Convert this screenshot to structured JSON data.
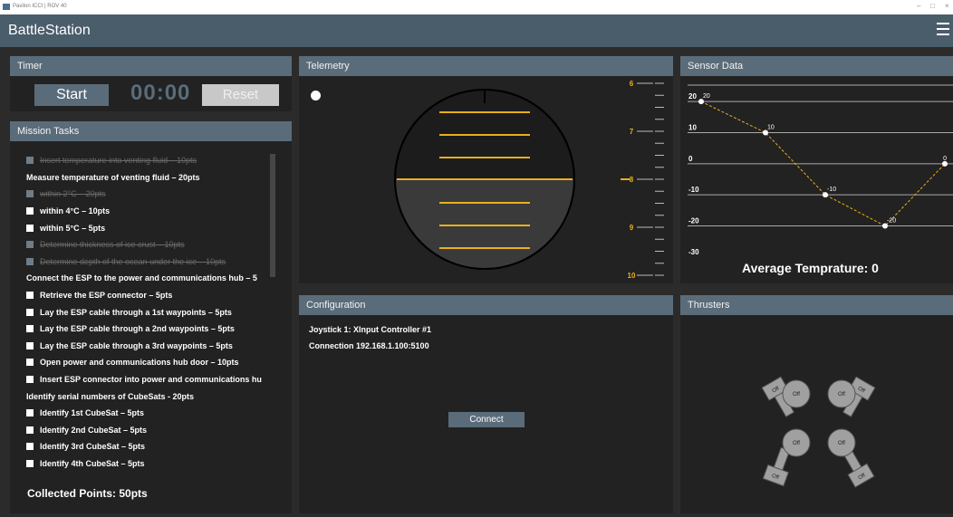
{
  "window": {
    "title": "Pavilon ICCI | ROV 40",
    "controls": [
      "–",
      "□",
      "×"
    ]
  },
  "app": {
    "name": "BattleStation",
    "menu_icon": "hamburger-icon"
  },
  "timer": {
    "title": "Timer",
    "start_label": "Start",
    "time": "00:00",
    "reset_label": "Reset"
  },
  "mission": {
    "title": "Mission Tasks",
    "tasks": [
      {
        "text": "Insert temperature into venting fluid – 10pts",
        "state": "done"
      },
      {
        "text": "Measure temperature of venting fluid – 20pts",
        "state": "header"
      },
      {
        "text": "within 2°C – 20pts",
        "state": "done"
      },
      {
        "text": "within 4°C – 10pts",
        "state": "open"
      },
      {
        "text": "within 5°C – 5pts",
        "state": "open"
      },
      {
        "text": "Determine thickness of ice crust – 10pts",
        "state": "done"
      },
      {
        "text": "Determine depth of the ocean under the ice – 10pts",
        "state": "done"
      },
      {
        "text": "Connect the ESP to the power and communications hub – 5",
        "state": "header"
      },
      {
        "text": "Retrieve the ESP connector – 5pts",
        "state": "open"
      },
      {
        "text": "Lay the ESP cable through a 1st waypoints  – 5pts",
        "state": "open"
      },
      {
        "text": "Lay the ESP cable through a 2nd waypoints  – 5pts",
        "state": "open"
      },
      {
        "text": "Lay the ESP cable through a 3rd waypoints  – 5pts",
        "state": "open"
      },
      {
        "text": "Open power and communications hub door – 10pts",
        "state": "open"
      },
      {
        "text": "Insert ESP connector into power and communications hu",
        "state": "open"
      },
      {
        "text": "Identify serial numbers of CubeSats - 20pts",
        "state": "header"
      },
      {
        "text": "Identify 1st CubeSat – 5pts",
        "state": "open"
      },
      {
        "text": "Identify 2nd CubeSat – 5pts",
        "state": "open"
      },
      {
        "text": "Identify 3rd CubeSat – 5pts",
        "state": "open"
      },
      {
        "text": "Identify 4th CubeSat – 5pts",
        "state": "open"
      }
    ],
    "collected": "Collected Points: 50pts"
  },
  "telemetry": {
    "title": "Telemetry",
    "depth_scale_labels": [
      "6",
      "7",
      "8",
      "9",
      "10"
    ],
    "current_depth": 8,
    "accent_color": "#e8b01c"
  },
  "sensor": {
    "title": "Sensor Data",
    "y_labels": [
      "20",
      "10",
      "0",
      "-10",
      "-20",
      "-30"
    ],
    "average_label": "Average Temprature: 0",
    "line_color": "#e8b01c"
  },
  "chart_data": {
    "type": "line",
    "title": "",
    "ylim": [
      -30,
      20
    ],
    "series": [
      {
        "values": [
          20,
          10,
          -10,
          -20,
          0
        ]
      }
    ],
    "point_labels": [
      "20",
      "10",
      "-10",
      "-20",
      "0"
    ]
  },
  "config": {
    "title": "Configuration",
    "joystick": "Joystick 1: XInput Controller #1",
    "connection": "Connection 192.168.1.100:5100",
    "connect_label": "Connect"
  },
  "thrusters": {
    "title": "Thrusters",
    "state_label": "Off",
    "vertical": [
      "Off",
      "Off",
      "Off",
      "Off"
    ],
    "horizontal": [
      "Off",
      "Off",
      "Off",
      "Off"
    ]
  }
}
